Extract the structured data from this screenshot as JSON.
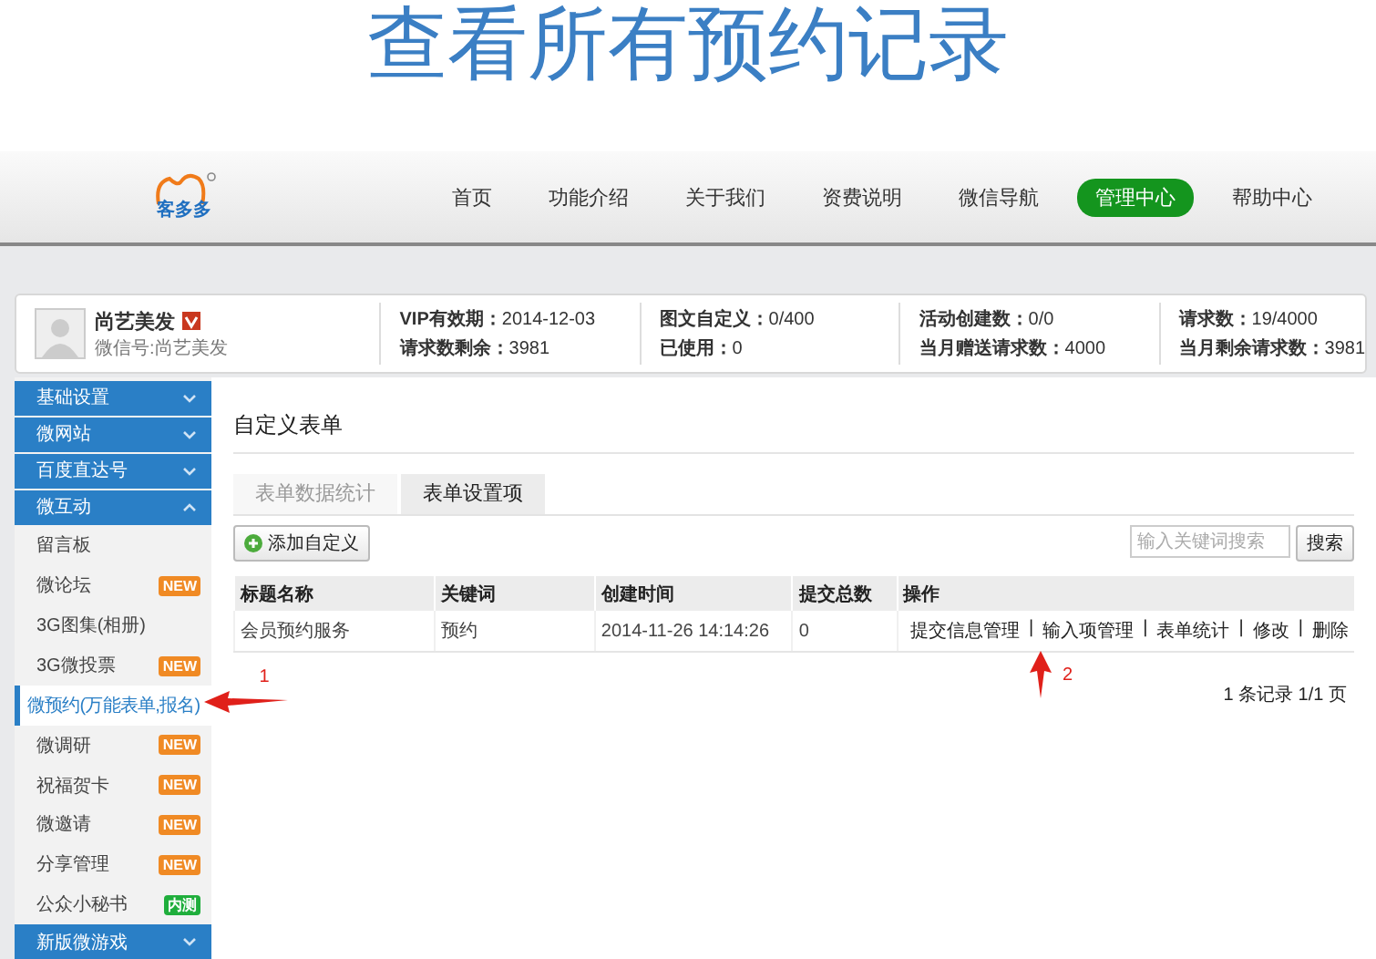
{
  "page_title": "查看所有预约记录",
  "header": {
    "logo": "客多多",
    "nav": [
      {
        "label": "首页",
        "selected": false
      },
      {
        "label": "功能介绍",
        "selected": false
      },
      {
        "label": "关于我们",
        "selected": false
      },
      {
        "label": "资费说明",
        "selected": false
      },
      {
        "label": "微信导航",
        "selected": false
      },
      {
        "label": "管理中心",
        "selected": true
      },
      {
        "label": "帮助中心",
        "selected": false
      }
    ]
  },
  "profile": {
    "name": "尚艺美发",
    "wechat_id": "微信号:尚艺美发",
    "stats": [
      {
        "label": "VIP有效期：",
        "value": "2014-12-03"
      },
      {
        "label": "请求数剩余：",
        "value": "3981"
      },
      {
        "label": "图文自定义：",
        "value": "0/400"
      },
      {
        "label": "已使用：",
        "value": "0"
      },
      {
        "label": "活动创建数：",
        "value": "0/0"
      },
      {
        "label": "当月赠送请求数：",
        "value": "4000"
      },
      {
        "label": "请求数：",
        "value": "19/4000"
      },
      {
        "label": "当月剩余请求数：",
        "value": "3981"
      }
    ]
  },
  "sidebar": {
    "items": [
      {
        "kind": "section",
        "label": "基础设置",
        "expanded": false
      },
      {
        "kind": "section",
        "label": "微网站",
        "expanded": false
      },
      {
        "kind": "section",
        "label": "百度直达号",
        "expanded": false
      },
      {
        "kind": "section",
        "label": "微互动",
        "expanded": true
      },
      {
        "kind": "item",
        "label": "留言板",
        "selected": false
      },
      {
        "kind": "item",
        "label": "微论坛",
        "selected": false,
        "badge": {
          "text": "NEW",
          "color": "#f08a24"
        }
      },
      {
        "kind": "item",
        "label": "3G图集(相册)",
        "selected": false
      },
      {
        "kind": "item",
        "label": "3G微投票",
        "selected": false,
        "badge": {
          "text": "NEW",
          "color": "#f08a24"
        }
      },
      {
        "kind": "item",
        "label": "微预约(万能表单,报名)",
        "selected": true
      },
      {
        "kind": "item",
        "label": "微调研",
        "selected": false,
        "badge": {
          "text": "NEW",
          "color": "#f08a24"
        }
      },
      {
        "kind": "item",
        "label": "祝福贺卡",
        "selected": false,
        "badge": {
          "text": "NEW",
          "color": "#f08a24"
        }
      },
      {
        "kind": "item",
        "label": "微邀请",
        "selected": false,
        "badge": {
          "text": "NEW",
          "color": "#f08a24"
        }
      },
      {
        "kind": "item",
        "label": "分享管理",
        "selected": false,
        "badge": {
          "text": "NEW",
          "color": "#f08a24"
        }
      },
      {
        "kind": "item",
        "label": "公众小秘书",
        "selected": false,
        "badge": {
          "text": "内测",
          "color": "#1fae3c"
        }
      },
      {
        "kind": "section",
        "label": "新版微游戏",
        "expanded": false
      }
    ]
  },
  "content": {
    "title": "自定义表单",
    "tabs": [
      {
        "label": "表单数据统计",
        "selected": false
      },
      {
        "label": "表单设置项",
        "selected": true
      }
    ],
    "add_button": "添加自定义",
    "search": {
      "placeholder": "输入关键词搜索",
      "button": "搜索"
    },
    "table": {
      "columns": [
        "标题名称",
        "关键词",
        "创建时间",
        "提交总数",
        "操作"
      ],
      "action_separator": "|",
      "rows": [
        {
          "cells": [
            "会员预约服务",
            "预约",
            "2014-11-26 14:14:26",
            "0"
          ],
          "actions": [
            "提交信息管理",
            "输入项管理",
            "表单统计",
            "修改",
            "删除"
          ]
        }
      ]
    },
    "pagination": "1 条记录 1/1 页"
  },
  "annotations": [
    {
      "label": "1",
      "kind": "left"
    },
    {
      "label": "2",
      "kind": "up"
    }
  ]
}
